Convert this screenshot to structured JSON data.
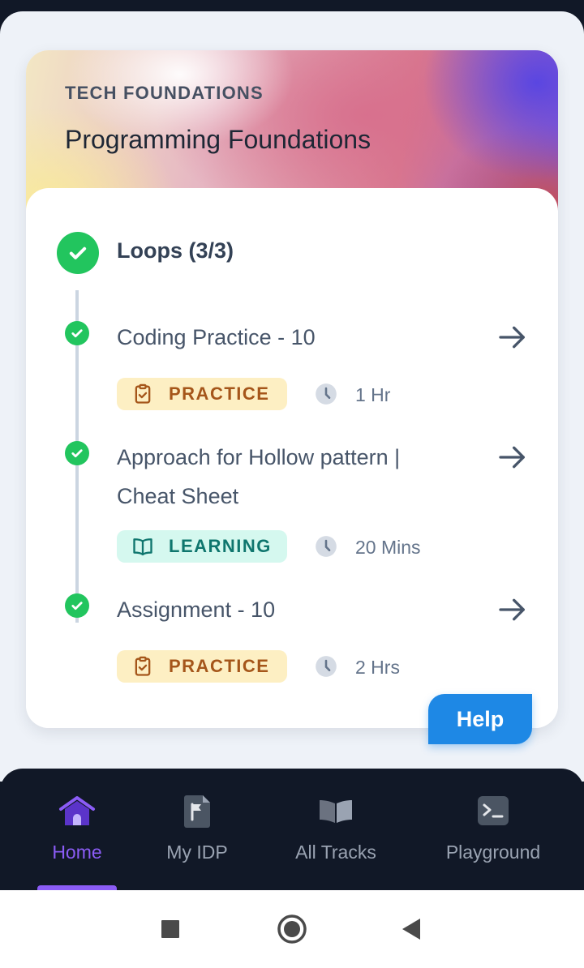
{
  "course": {
    "track_label": "TECH FOUNDATIONS",
    "title": "Programming Foundations"
  },
  "section": {
    "title": "Loops (3/3)",
    "status": "completed"
  },
  "items": [
    {
      "title": "Coding Practice - 10",
      "type_label": "PRACTICE",
      "type_icon": "clipboard-check-icon",
      "duration": "1 Hr",
      "status": "completed"
    },
    {
      "title": "Approach for Hollow pattern | Cheat Sheet",
      "type_label": "LEARNING",
      "type_icon": "open-book-icon",
      "duration": "20 Mins",
      "status": "completed"
    },
    {
      "title": "Assignment - 10",
      "type_label": "PRACTICE",
      "type_icon": "clipboard-check-icon",
      "duration": "2 Hrs",
      "status": "completed"
    }
  ],
  "help": {
    "label": "Help"
  },
  "nav": {
    "items": [
      {
        "label": "Home",
        "icon": "home-icon",
        "active": true
      },
      {
        "label": "My IDP",
        "icon": "flag-document-icon",
        "active": false
      },
      {
        "label": "All Tracks",
        "icon": "book-icon",
        "active": false
      },
      {
        "label": "Playground",
        "icon": "terminal-icon",
        "active": false
      }
    ]
  },
  "system_nav": {
    "buttons": [
      "recents-square-icon",
      "home-circle-icon",
      "back-triangle-icon"
    ]
  },
  "colors": {
    "app_background": "#eef2f8",
    "check_green": "#22c55e",
    "practice_badge_bg": "#fdefc3",
    "practice_badge_text": "#a5561a",
    "learning_badge_bg": "#d5f8ef",
    "learning_badge_text": "#0f766e",
    "help_button": "#1e88e5",
    "nav_background": "#111827",
    "nav_active": "#8b5cf6",
    "nav_inactive": "#9aa3b2"
  }
}
